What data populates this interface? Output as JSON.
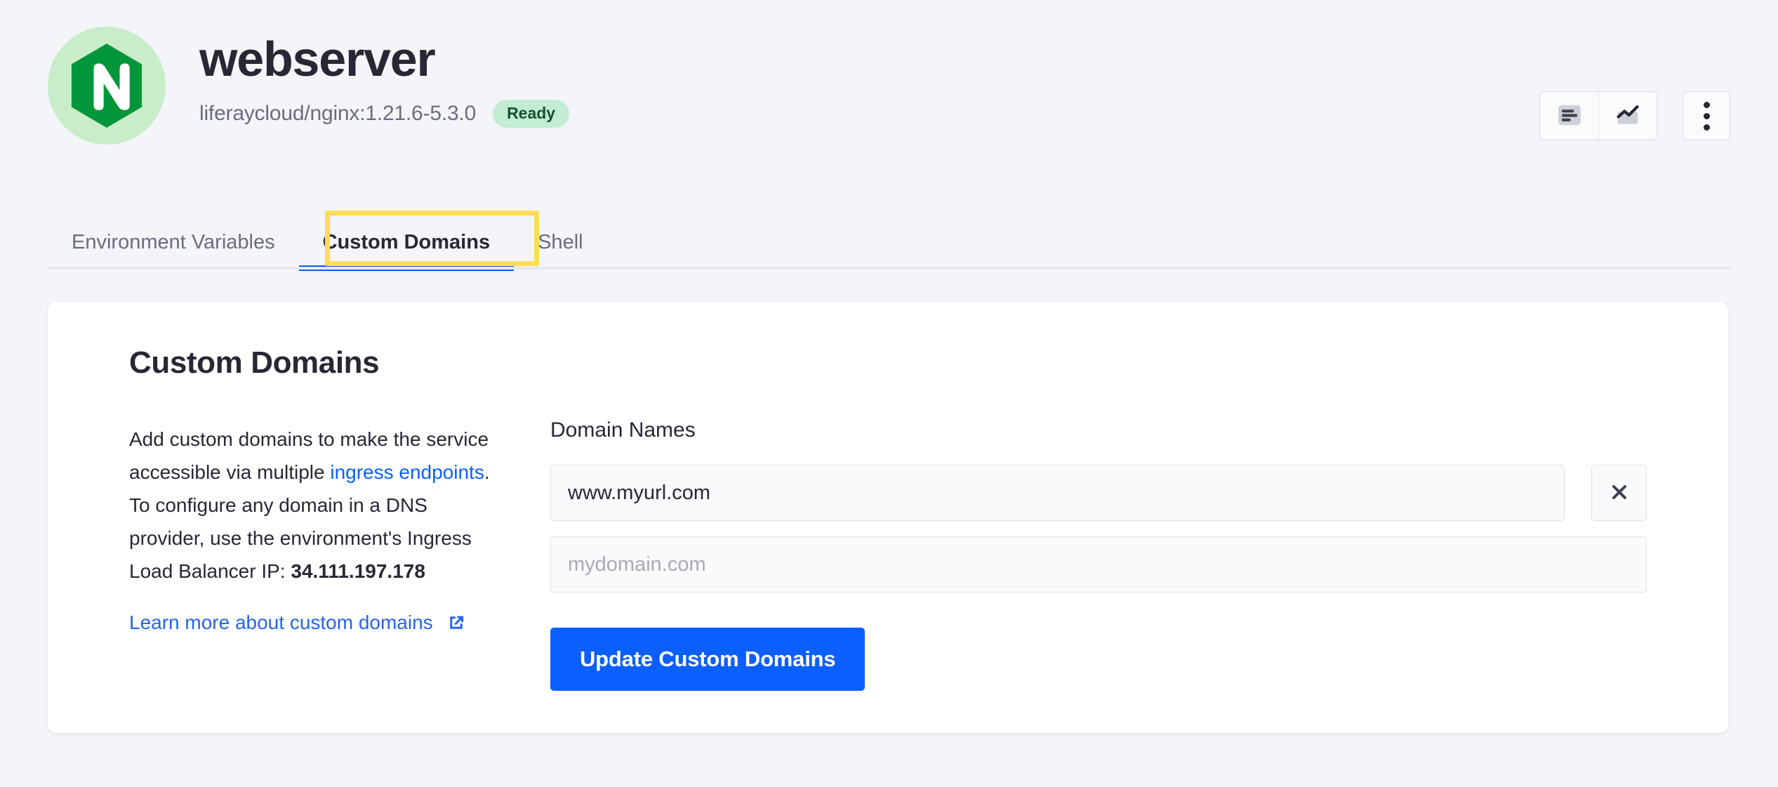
{
  "header": {
    "title": "webserver",
    "image_tag": "liferaycloud/nginx:1.21.6-5.3.0",
    "status": "Ready",
    "logo_icon": "nginx-hexagon-logo",
    "logo_bg_color": "#c9ecc9",
    "logo_color": "#009639",
    "status_bg_color": "#c2ecd4",
    "status_text_color": "#14532d",
    "actions": {
      "logs_icon": "logs-lines-icon",
      "metrics_icon": "metrics-chart-icon",
      "overflow_icon": "three-dots-vertical-icon"
    }
  },
  "tabs": {
    "items": [
      {
        "label": "Environment Variables",
        "active": false
      },
      {
        "label": "Custom Domains",
        "active": true
      },
      {
        "label": "Shell",
        "active": false
      }
    ],
    "active_index": 1,
    "highlight_color": "#ffdd57",
    "active_underline_color": "#0b5fff"
  },
  "card": {
    "title": "Custom Domains",
    "description": {
      "part1": "Add custom domains to make the service accessible via multiple ",
      "link_text": "ingress endpoints",
      "part2": ". To configure any domain in a DNS provider, use the environment's Ingress Load Balancer IP: ",
      "ip": "34.111.197.178",
      "learn_more": "Learn more about custom domains",
      "external_link_icon": "external-link-icon",
      "link_color": "#0b5fff"
    },
    "form": {
      "field_label": "Domain Names",
      "domains": [
        {
          "value": "www.myurl.com",
          "placeholder": "mydomain.com",
          "removable": true
        },
        {
          "value": "",
          "placeholder": "mydomain.com",
          "removable": false
        }
      ],
      "remove_icon": "close-x-icon",
      "submit_label": "Update Custom Domains",
      "submit_color": "#0b5fff"
    }
  }
}
